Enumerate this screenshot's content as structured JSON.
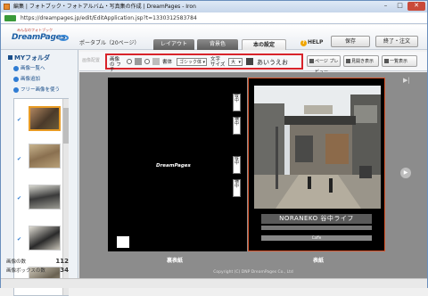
{
  "window": {
    "title": "編集 | フォトブック・フォトアルバム・写真集の作成 | DreamPages - Iron",
    "url": "https://dreampages.jp/edit/EditApplication.jsp?t=1330312583784",
    "minimize": "–",
    "maximize": "□",
    "close": "✕"
  },
  "header": {
    "logo_tagline": "みんなのフォトブック",
    "logo": "DreamPages",
    "product": "ポータブル（20ページ）",
    "tabs": [
      {
        "label": "レイアウト"
      },
      {
        "label": "背景色"
      },
      {
        "label": "本の設定"
      }
    ],
    "help": "HELP",
    "save": "保存",
    "finish_order": "終了・注文"
  },
  "sidebar": {
    "title": "MYフォルダ",
    "links": [
      {
        "label": "画像一覧へ"
      },
      {
        "label": "画像追加"
      },
      {
        "label": "フリー画像を使う"
      }
    ],
    "image_count_label": "画像の数",
    "image_count": "112",
    "box_count_label": "画像ボックスの数",
    "box_count": "34"
  },
  "toolbar": {
    "muted_label": "画像配置",
    "frame_label": "画像の フチ",
    "font_label": "書体",
    "font_value": "ゴシック体",
    "size_label": "文字 サイズ",
    "size_value": "大",
    "preview_text": "あいうえお",
    "page_preview": "ページ プレビュー",
    "view_open": "見開き表示",
    "view_list": "一覧表示"
  },
  "canvas": {
    "left_page_logo": "DreamPages",
    "spine_labels": [
      "縦中",
      "横中",
      "縦中",
      "横中"
    ],
    "caption_title": "NORANEKO 谷中ライフ",
    "caption_small": "Caffe",
    "left_caption": "裏表紙",
    "right_caption": "表紙",
    "last_button": "▶|",
    "next_button": "▶",
    "copyright": "Copyright (C) DNP DreamPages Co., Ltd"
  },
  "colors": {
    "accent": "#d8232a",
    "frame_swatch_1": "#9a9a9a",
    "frame_swatch_2": "#bdbdbd",
    "font_color_swatch": "#444444"
  }
}
